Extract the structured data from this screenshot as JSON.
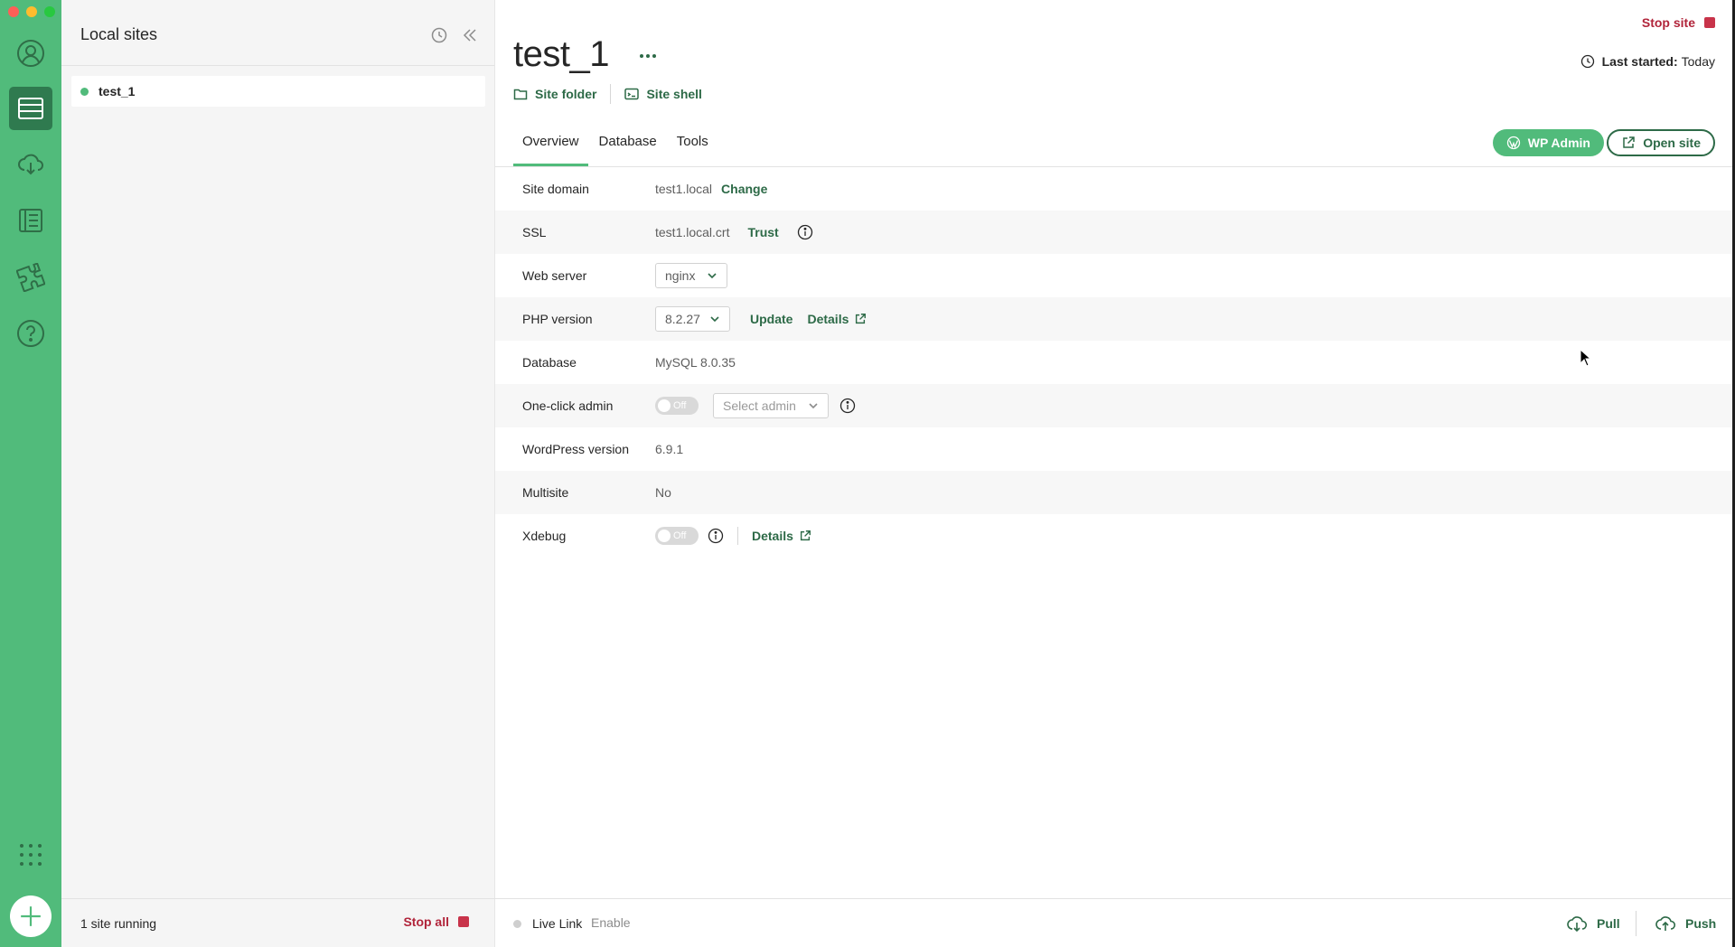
{
  "sidebar": {
    "title": "Local sites",
    "sites": [
      {
        "name": "test_1",
        "status": "running"
      }
    ],
    "footer": {
      "running_text": "1 site running",
      "stop_all_label": "Stop all"
    }
  },
  "rail": {
    "icons": [
      "user-icon",
      "sites-icon",
      "cloud-icon",
      "blueprints-icon",
      "addons-icon",
      "help-icon",
      "grid-icon",
      "plus-icon"
    ]
  },
  "site": {
    "title": "test_1",
    "site_folder_label": "Site folder",
    "site_shell_label": "Site shell",
    "stop_site_label": "Stop site",
    "last_started_label": "Last started:",
    "last_started_value": "Today"
  },
  "tabs": [
    {
      "label": "Overview",
      "active": true
    },
    {
      "label": "Database",
      "active": false
    },
    {
      "label": "Tools",
      "active": false
    }
  ],
  "actions": {
    "wp_admin_label": "WP Admin",
    "open_site_label": "Open site"
  },
  "overview": {
    "site_domain": {
      "label": "Site domain",
      "value": "test1.local",
      "action": "Change"
    },
    "ssl": {
      "label": "SSL",
      "value": "test1.local.crt",
      "action": "Trust"
    },
    "web_server": {
      "label": "Web server",
      "value": "nginx"
    },
    "php_version": {
      "label": "PHP version",
      "value": "8.2.27",
      "update": "Update",
      "details": "Details"
    },
    "database": {
      "label": "Database",
      "value": "MySQL 8.0.35"
    },
    "one_click_admin": {
      "label": "One-click admin",
      "toggle": "Off",
      "placeholder": "Select admin"
    },
    "wordpress_version": {
      "label": "WordPress version",
      "value": "6.9.1"
    },
    "multisite": {
      "label": "Multisite",
      "value": "No"
    },
    "xdebug": {
      "label": "Xdebug",
      "toggle": "Off",
      "details": "Details"
    }
  },
  "bottom": {
    "live_link_label": "Live Link",
    "enable_label": "Enable",
    "pull_label": "Pull",
    "push_label": "Push"
  },
  "colors": {
    "brand_green": "#51bb7b",
    "dark_green": "#2d6a47",
    "stop_red": "#c8334a"
  }
}
